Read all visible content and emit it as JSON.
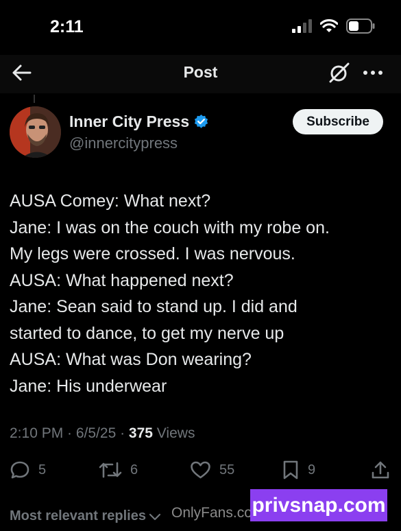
{
  "status_bar": {
    "time": "2:11"
  },
  "nav": {
    "title": "Post"
  },
  "author": {
    "name": "Inner City Press",
    "handle": "@innercitypress",
    "verified": true,
    "verified_color": "#1d9bf0"
  },
  "subscribe_label": "Subscribe",
  "post": {
    "lines": [
      "AUSA Comey: What next?",
      "Jane: I was on the couch with my robe on.",
      "My legs were crossed. I was nervous.",
      "AUSA: What happened next?",
      "Jane: Sean said to stand up. I did and",
      "started to dance, to get my nerve up",
      "AUSA: What was Don wearing?",
      "Jane: His underwear"
    ],
    "timestamp": "2:10 PM · 6/5/25 · ",
    "views_count": "375",
    "views_label": " Views"
  },
  "actions": {
    "replies": "5",
    "reposts": "6",
    "likes": "55",
    "bookmarks": "9"
  },
  "replies_sort": "Most relevant replies",
  "watermark_text": "OnlyFans.com/",
  "overlay_label": "privsnap.com",
  "colors": {
    "background": "#000000",
    "muted": "#71767b",
    "overlay": "#8b3ff0"
  }
}
